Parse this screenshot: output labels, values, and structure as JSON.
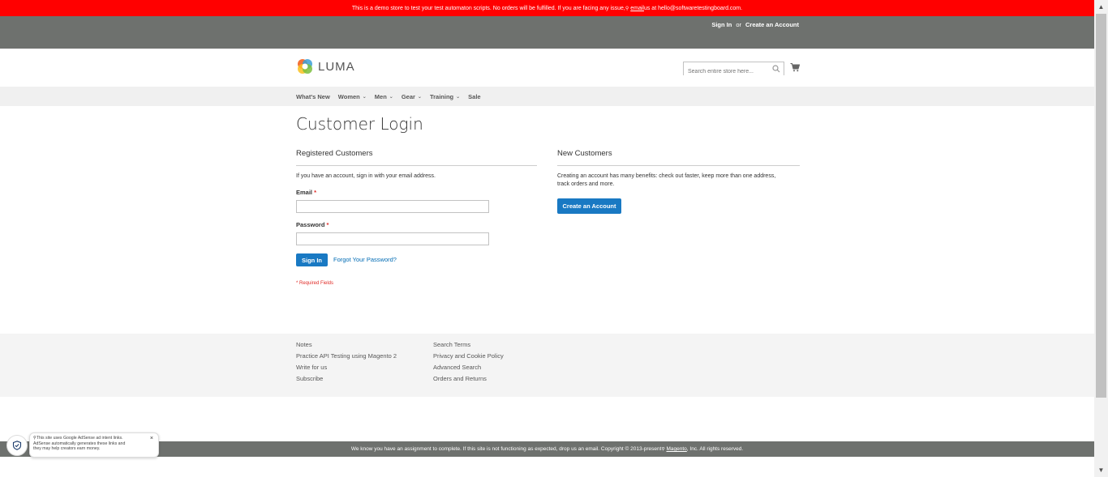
{
  "demo_banner": {
    "text_before": "This is a demo store to test your test automaton scripts. No orders will be fulfilled. If you are facing any issue, ",
    "email_link": "email",
    "text_after": " us at hello@softwaretestingboard.com."
  },
  "header_links": {
    "sign_in": "Sign In",
    "or": "or",
    "create_account": "Create an Account"
  },
  "logo": {
    "text": "LUMA"
  },
  "search": {
    "placeholder": "Search entire store here..."
  },
  "nav": {
    "items": [
      {
        "label": "What's New",
        "has_dropdown": false
      },
      {
        "label": "Women",
        "has_dropdown": true
      },
      {
        "label": "Men",
        "has_dropdown": true
      },
      {
        "label": "Gear",
        "has_dropdown": true
      },
      {
        "label": "Training",
        "has_dropdown": true
      },
      {
        "label": "Sale",
        "has_dropdown": false
      }
    ]
  },
  "login": {
    "page_title": "Customer Login",
    "registered": {
      "title": "Registered Customers",
      "note": "If you have an account, sign in with your email address.",
      "email_label": "Email",
      "password_label": "Password",
      "required_mark": "*",
      "email_value": "",
      "password_value": "",
      "sign_in_button": "Sign In",
      "forgot_link": "Forgot Your Password?",
      "required_note": "* Required Fields"
    },
    "new_customers": {
      "title": "New Customers",
      "note_line1": "Creating an account has many benefits: check out faster, keep more than one address,",
      "note_line2": "track orders and more.",
      "create_button": "Create an Account"
    }
  },
  "footer": {
    "col1": [
      "Notes",
      "Practice API Testing using Magento 2",
      "Write for us",
      "Subscribe"
    ],
    "col2": [
      "Search Terms",
      "Privacy and Cookie Policy",
      "Advanced Search",
      "Orders and Returns"
    ]
  },
  "copyright": {
    "text_before": "We know you have an assignment to complete. If this site is not functioning as expected, drop us an email. Copyright © 2013-present ",
    "magento_link": "Magento",
    "text_after": ", Inc. All rights reserved."
  },
  "adsense_popup": {
    "line1": "This site uses Google AdSense ad intent links.",
    "line2": "AdSense automatically generates these links and",
    "line3": "they may help creators earn money.",
    "close": "×"
  },
  "colors": {
    "banner_red": "#ff0000",
    "header_gray": "#6e716e",
    "primary_blue": "#1979c3",
    "link_blue": "#006bb4",
    "required_red": "#e02b27"
  }
}
